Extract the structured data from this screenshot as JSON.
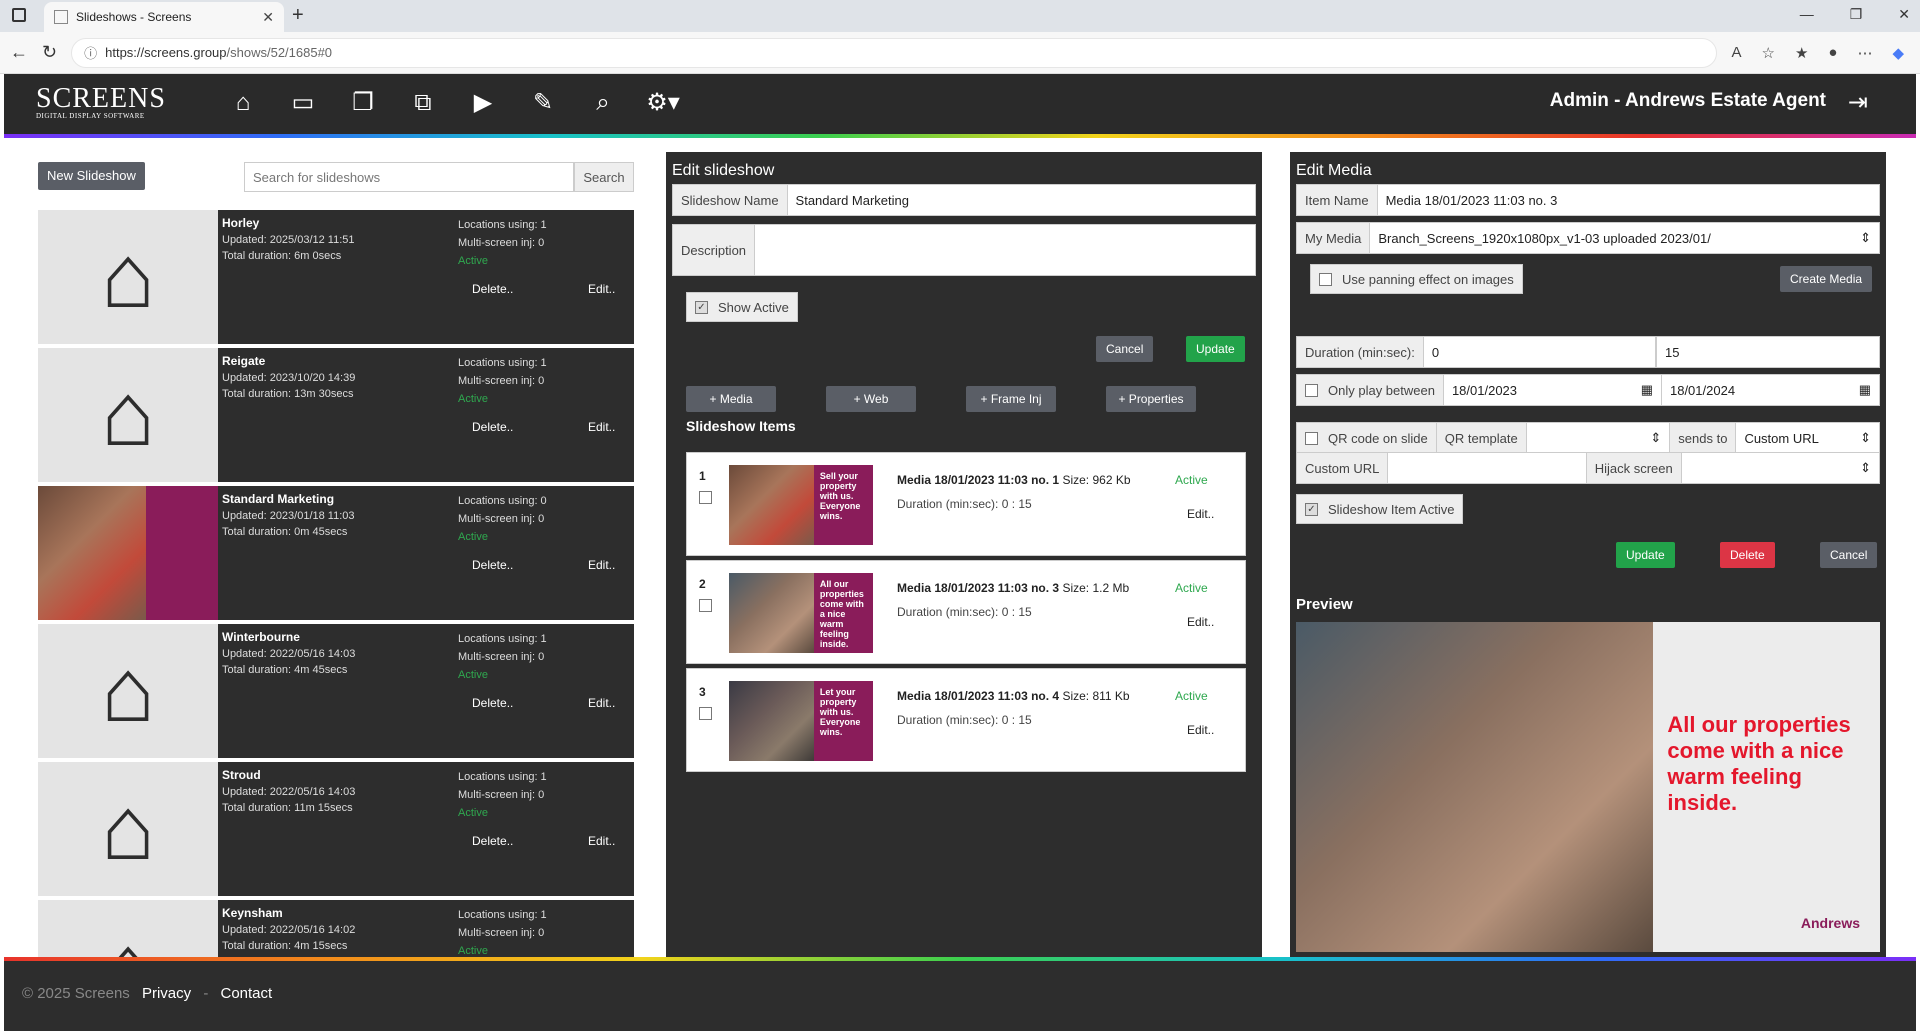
{
  "browser": {
    "tab_title": "Slideshows - Screens",
    "url_host": "https://screens.group",
    "url_path": "/shows/52/1685#0"
  },
  "header": {
    "logo_main": "SCREENS",
    "logo_sub": "DIGITAL DISPLAY SOFTWARE",
    "admin": "Admin - Andrews Estate Agent",
    "nav_icons": [
      "home-icon",
      "screens-icon",
      "slideshows-icon",
      "media-icon",
      "video-icon",
      "edit-icon",
      "locations-icon",
      "settings-icon"
    ]
  },
  "left": {
    "new_btn": "New Slideshow",
    "search_placeholder": "Search for slideshows",
    "search_btn": "Search",
    "slideshows": [
      {
        "name": "Horley",
        "updated": "Updated: 2025/03/12 11:51",
        "duration": "Total duration: 6m 0secs",
        "locations": "Locations using: 1",
        "multi": "Multi-screen inj: 0",
        "active": "Active",
        "thumb": "house"
      },
      {
        "name": "Reigate",
        "updated": "Updated: 2023/10/20 14:39",
        "duration": "Total duration: 13m 30secs",
        "locations": "Locations using: 1",
        "multi": "Multi-screen inj: 0",
        "active": "Active",
        "thumb": "house"
      },
      {
        "name": "Standard Marketing",
        "updated": "Updated: 2023/01/18 11:03",
        "duration": "Total duration: 0m 45secs",
        "locations": "Locations using: 0",
        "multi": "Multi-screen inj: 0",
        "active": "Active",
        "thumb": "ad"
      },
      {
        "name": "Winterbourne",
        "updated": "Updated: 2022/05/16 14:03",
        "duration": "Total duration: 4m 45secs",
        "locations": "Locations using: 1",
        "multi": "Multi-screen inj: 0",
        "active": "Active",
        "thumb": "house"
      },
      {
        "name": "Stroud",
        "updated": "Updated: 2022/05/16 14:03",
        "duration": "Total duration: 11m 15secs",
        "locations": "Locations using: 1",
        "multi": "Multi-screen inj: 0",
        "active": "Active",
        "thumb": "house"
      },
      {
        "name": "Keynsham",
        "updated": "Updated: 2022/05/16 14:02",
        "duration": "Total duration: 4m 15secs",
        "locations": "Locations using: 1",
        "multi": "Multi-screen inj: 0",
        "active": "Active",
        "thumb": "house"
      }
    ],
    "delete": "Delete..",
    "edit": "Edit.."
  },
  "middle": {
    "title": "Edit slideshow",
    "name_label": "Slideshow Name",
    "name_value": "Standard Marketing",
    "desc_label": "Description",
    "show_active": "Show Active",
    "cancel": "Cancel",
    "update": "Update",
    "add_media": "+ Media",
    "add_web": "+ Web",
    "add_frame": "+ Frame Inj",
    "add_props": "+ Properties",
    "items_title": "Slideshow Items",
    "items": [
      {
        "num": "1",
        "title": "Media 18/01/2023 11:03 no. 1",
        "size": "Size: 962 Kb",
        "duration": "Duration (min:sec): 0 : 15",
        "active": "Active",
        "ad": "Sell your property with us. Everyone wins."
      },
      {
        "num": "2",
        "title": "Media 18/01/2023 11:03 no. 3",
        "size": "Size: 1.2 Mb",
        "duration": "Duration (min:sec): 0 : 15",
        "active": "Active",
        "ad": "All our properties come with a nice warm feeling inside."
      },
      {
        "num": "3",
        "title": "Media 18/01/2023 11:03 no. 4",
        "size": "Size: 811 Kb",
        "duration": "Duration (min:sec): 0 : 15",
        "active": "Active",
        "ad": "Let your property with us. Everyone wins."
      }
    ],
    "edit": "Edit.."
  },
  "right": {
    "title": "Edit Media",
    "item_name_label": "Item Name",
    "item_name": "Media 18/01/2023 11:03 no. 3",
    "my_media_label": "My Media",
    "my_media": "Branch_Screens_1920x1080px_v1-03 uploaded 2023/01/",
    "panning": "Use panning effect on images",
    "create_media": "Create Media",
    "duration_label": "Duration (min:sec):",
    "dur_min": "0",
    "dur_sec": "15",
    "only_play": "Only play between",
    "date_from": "18/01/2023",
    "date_to": "18/01/2024",
    "qr_label": "QR code on slide",
    "qr_template": "QR template",
    "sends_to": "sends to",
    "custom_url_sel": "Custom URL",
    "custom_url_label": "Custom URL",
    "hijack": "Hijack screen",
    "item_active": "Slideshow Item Active",
    "update": "Update",
    "delete": "Delete",
    "cancel": "Cancel",
    "preview_title": "Preview",
    "preview_text": "All our properties come with a nice warm feeling inside.",
    "preview_brand": "Andrews"
  },
  "footer": {
    "copyright": "© 2025 Screens",
    "privacy": "Privacy",
    "sep": "-",
    "contact": "Contact"
  }
}
